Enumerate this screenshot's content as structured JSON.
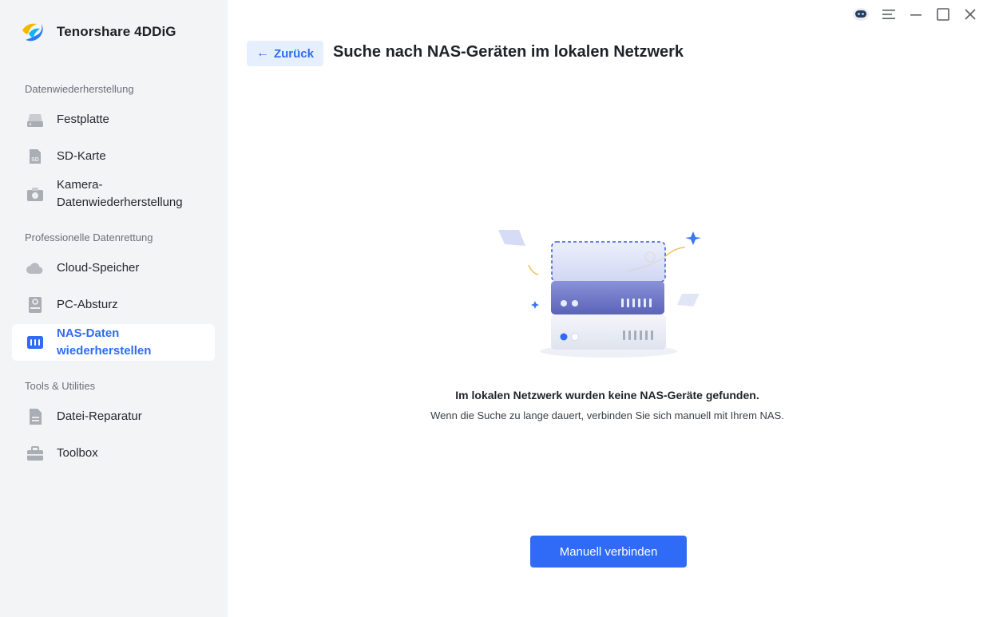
{
  "app": {
    "name": "Tenorshare 4DDiG"
  },
  "sidebar": {
    "sections": [
      {
        "title": "Datenwiederherstellung"
      },
      {
        "title": "Professionelle Datenrettung"
      },
      {
        "title": "Tools & Utilities"
      }
    ],
    "items": [
      {
        "label": "Festplatte",
        "icon": "hard-drive-icon"
      },
      {
        "label": "SD-Karte",
        "icon": "sd-card-icon"
      },
      {
        "label": "Kamera-\nDatenwiederherstellung",
        "icon": "camera-icon"
      },
      {
        "label": "Cloud-Speicher",
        "icon": "cloud-icon"
      },
      {
        "label": "PC-Absturz",
        "icon": "pc-crash-icon"
      },
      {
        "label": "NAS-Daten\nwiederherstellen",
        "icon": "nas-icon",
        "active": true
      },
      {
        "label": "Datei-Reparatur",
        "icon": "file-repair-icon"
      },
      {
        "label": "Toolbox",
        "icon": "toolbox-icon"
      }
    ]
  },
  "window_controls": [
    "assistant-icon",
    "menu-icon",
    "minimize-icon",
    "maximize-icon",
    "close-icon"
  ],
  "header": {
    "back_label": "Zurück",
    "title": "Suche nach NAS-Geräten im lokalen Netzwerk"
  },
  "empty_state": {
    "title": "Im lokalen Netzwerk wurden keine NAS-Geräte gefunden.",
    "subtitle": "Wenn die Suche zu lange dauert, verbinden Sie sich manuell mit Ihrem NAS."
  },
  "primary_button": {
    "label": "Manuell verbinden"
  },
  "colors": {
    "accent": "#2f6bf6",
    "sidebar_bg": "#f3f4f6",
    "back_bg": "#e6effe"
  }
}
